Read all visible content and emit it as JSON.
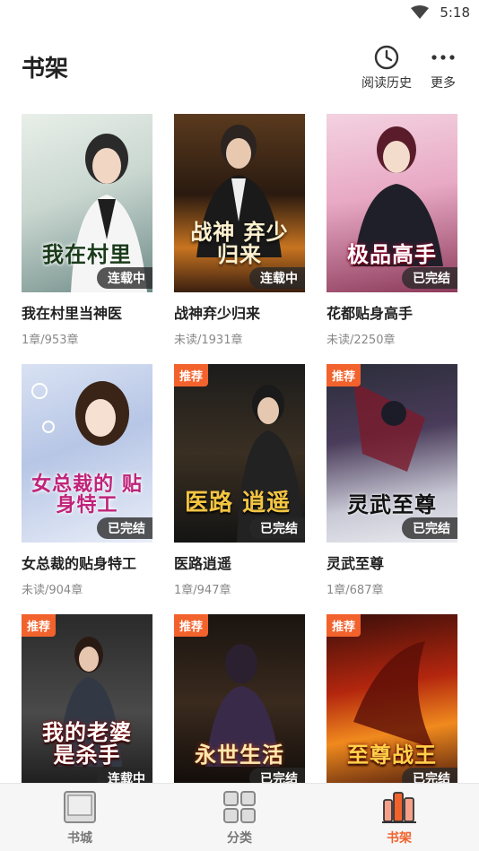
{
  "status_bar": {
    "time": "5:18"
  },
  "header": {
    "title": "书架",
    "history_label": "阅读历史",
    "more_label": "更多"
  },
  "books": [
    {
      "title": "我在村里当神医",
      "progress": "1章/953章",
      "cover_text": "我在村里",
      "badge": "",
      "status": "连载中"
    },
    {
      "title": "战神弃少归来",
      "progress": "未读/1931章",
      "cover_text": "战神 弃少归来",
      "badge": "",
      "status": "连载中"
    },
    {
      "title": "花都贴身高手",
      "progress": "未读/2250章",
      "cover_text": "极品高手",
      "badge": "",
      "status": "已完结"
    },
    {
      "title": "女总裁的贴身特工",
      "progress": "未读/904章",
      "cover_text": "女总裁的 贴身特工",
      "badge": "",
      "status": "已完结"
    },
    {
      "title": "医路逍遥",
      "progress": "1章/947章",
      "cover_text": "医路 逍遥",
      "badge": "推荐",
      "status": "已完结"
    },
    {
      "title": "灵武至尊",
      "progress": "1章/687章",
      "cover_text": "灵武至尊",
      "badge": "推荐",
      "status": "已完结"
    },
    {
      "title": "",
      "progress": "",
      "cover_text": "我的老婆 是杀手",
      "badge": "推荐",
      "status": "连载中"
    },
    {
      "title": "",
      "progress": "",
      "cover_text": "永世生活",
      "badge": "推荐",
      "status": "已完结"
    },
    {
      "title": "",
      "progress": "",
      "cover_text": "至尊战王",
      "badge": "推荐",
      "status": "已完结"
    }
  ],
  "nav": {
    "store_label": "书城",
    "category_label": "分类",
    "shelf_label": "书架",
    "active": "shelf",
    "accent": "#f2622c"
  }
}
